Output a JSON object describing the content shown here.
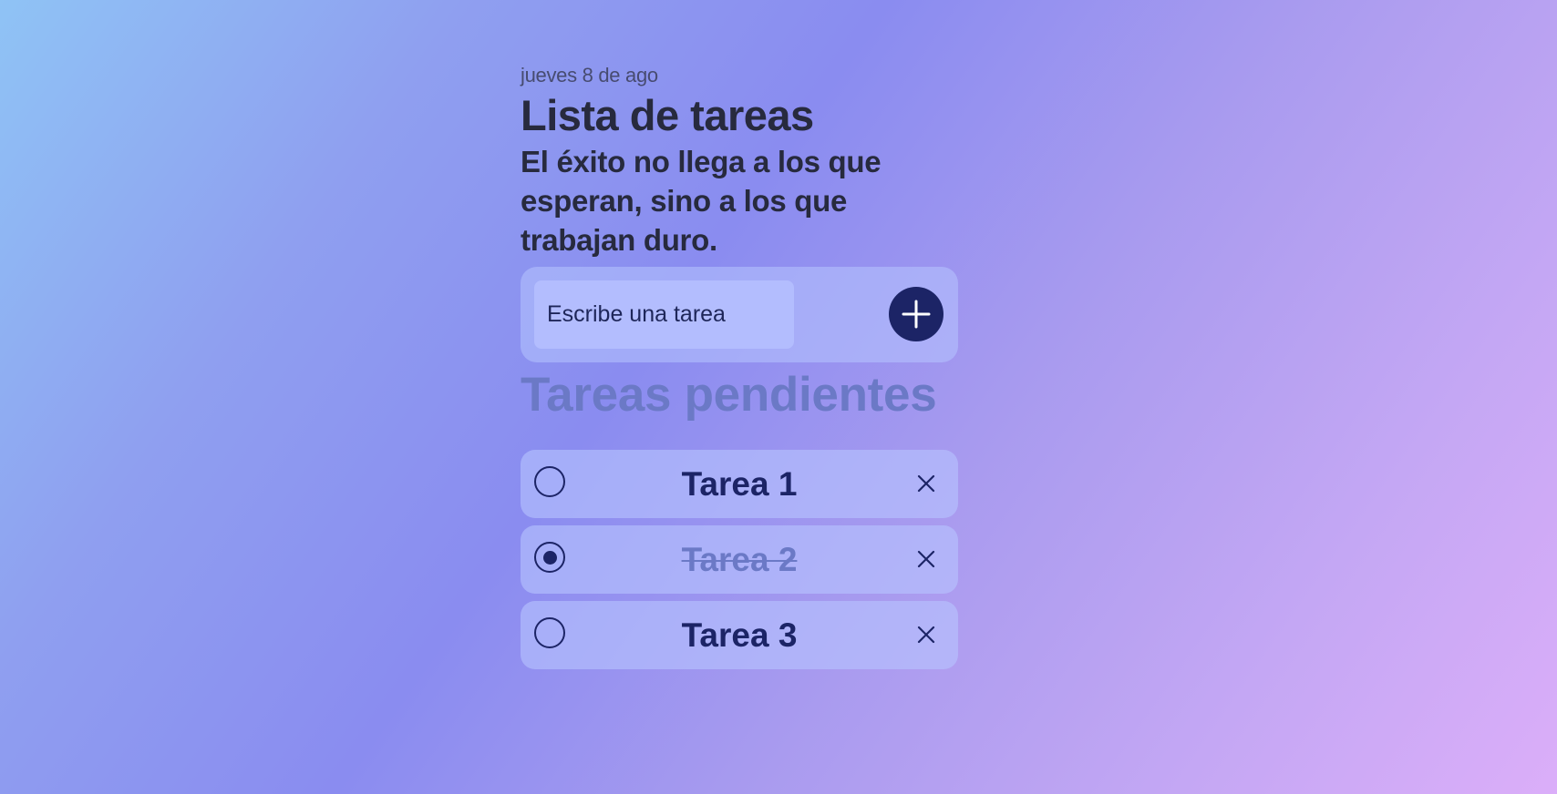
{
  "header": {
    "date": "jueves 8 de ago",
    "title": "Lista de tareas",
    "quote": "El éxito no llega a los que esperan, sino a los que trabajan duro."
  },
  "new_task": {
    "placeholder": "Escribe una tarea",
    "value": "",
    "add_icon": "plus-icon"
  },
  "pending": {
    "title": "Tareas pendientes",
    "tasks": [
      {
        "label": "Tarea 1",
        "completed": false
      },
      {
        "label": "Tarea 2",
        "completed": true
      },
      {
        "label": "Tarea 3",
        "completed": false
      }
    ]
  },
  "colors": {
    "primary": "#1c2466",
    "muted": "#6b79c6",
    "text": "#272a3e",
    "card": "#a5adf8",
    "input": "#b3bdfe"
  }
}
